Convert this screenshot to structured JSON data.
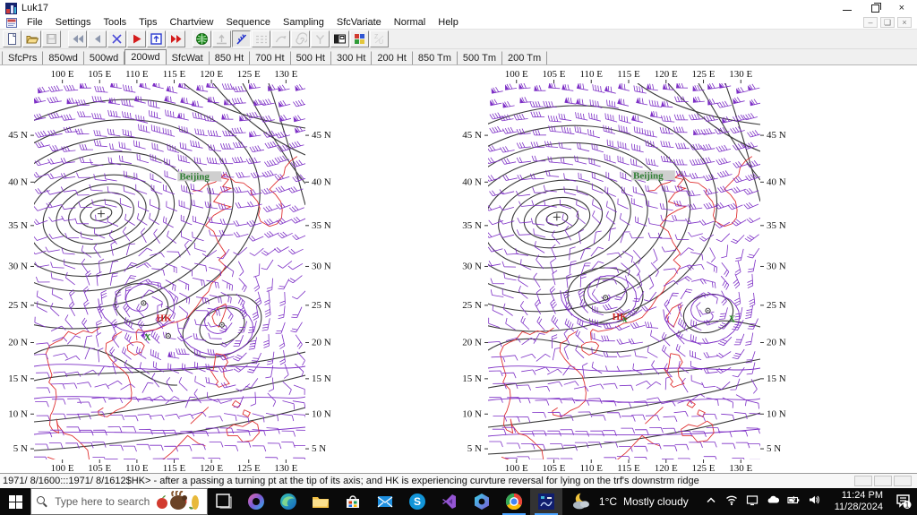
{
  "window": {
    "title": "Luk17"
  },
  "menu": {
    "items": [
      "File",
      "Settings",
      "Tools",
      "Tips",
      "Chartview",
      "Sequence",
      "Sampling",
      "SfcVariate",
      "Normal",
      "Help"
    ]
  },
  "toolbar": {
    "buttons": [
      {
        "name": "new",
        "enabled": true
      },
      {
        "name": "open",
        "enabled": true
      },
      {
        "name": "save",
        "enabled": false
      },
      {
        "name": "rewind",
        "enabled": true
      },
      {
        "name": "step-back",
        "enabled": true
      },
      {
        "name": "delete",
        "enabled": true
      },
      {
        "name": "play",
        "enabled": true
      },
      {
        "name": "fit-frame",
        "enabled": true
      },
      {
        "name": "fast-forward",
        "enabled": true
      },
      {
        "name": "globe",
        "enabled": true
      },
      {
        "name": "surface",
        "enabled": false
      },
      {
        "name": "wind-feather",
        "enabled": true,
        "active": true
      },
      {
        "name": "isolines",
        "enabled": false
      },
      {
        "name": "curve-arrow",
        "enabled": false
      },
      {
        "name": "spiral",
        "enabled": false
      },
      {
        "name": "branch",
        "enabled": false
      },
      {
        "name": "window-layout",
        "enabled": true
      },
      {
        "name": "palette",
        "enabled": true
      },
      {
        "name": "zu",
        "enabled": false
      }
    ]
  },
  "tabs": {
    "active_index": 3,
    "items": [
      "SfcPrs",
      "850wd",
      "500wd",
      "200wd",
      "SfcWat",
      "850 Ht",
      "700 Ht",
      "500 Ht",
      "300 Ht",
      "200 Ht",
      "850 Tm",
      "500 Tm",
      "200 Tm"
    ]
  },
  "chart": {
    "lon_labels": [
      "100 E",
      "105 E",
      "110 E",
      "115 E",
      "120 E",
      "125 E",
      "130 E"
    ],
    "lat_labels": [
      "45 N",
      "40 N",
      "35 N",
      "30 N",
      "25 N",
      "20 N",
      "15 N",
      "10 N",
      "5 N"
    ],
    "colors": {
      "contour": "#3a3a3a",
      "wind": "#7d2fc6",
      "coast": "#e03232",
      "green": "#2e7d32",
      "red": "#cc2222"
    },
    "panels": [
      {
        "name": "left-map",
        "annotations": [
          {
            "type": "label",
            "text": "Beijing",
            "lon": 115.7,
            "lat": 40.3,
            "color": "#2e7d32",
            "highlight": true
          },
          {
            "type": "plus",
            "text": "+",
            "lon": 105.2,
            "lat": 36.4,
            "color": "#333333"
          },
          {
            "type": "vortex",
            "lon": 110.9,
            "lat": 25.3
          },
          {
            "type": "vortex",
            "lon": 121.4,
            "lat": 22.4
          },
          {
            "type": "vortex",
            "lon": 114.2,
            "lat": 20.9
          },
          {
            "type": "label",
            "text": "HK",
            "lon": 112.6,
            "lat": 22.9,
            "color": "#cc2222"
          },
          {
            "type": "x",
            "text": "X",
            "lon": 111.0,
            "lat": 20.3,
            "color": "#1f8a1f"
          }
        ]
      },
      {
        "name": "right-map",
        "annotations": [
          {
            "type": "label",
            "text": "Beijing",
            "lon": 115.6,
            "lat": 40.4,
            "color": "#2e7d32",
            "highlight": true
          },
          {
            "type": "plus",
            "text": "+",
            "lon": 105.4,
            "lat": 36.0,
            "color": "#333333"
          },
          {
            "type": "vortex",
            "lon": 111.9,
            "lat": 26.0
          },
          {
            "type": "vortex",
            "lon": 125.6,
            "lat": 24.3
          },
          {
            "type": "label",
            "text": "HK",
            "lon": 112.8,
            "lat": 23.1,
            "color": "#cc2222"
          },
          {
            "type": "x",
            "text": "x",
            "lon": 114.2,
            "lat": 22.8,
            "color": "#1f8a1f"
          },
          {
            "type": "x",
            "text": "X",
            "lon": 128.4,
            "lat": 22.8,
            "color": "#1f8a1f"
          }
        ]
      }
    ]
  },
  "status_bar": {
    "text": "1971/ 8/1600:::1971/ 8/1612$HK> - after a passing  a turning pt at the tip of its axis; and HK is experiencing curvture reversal for lying on the trf's downstrm ridge"
  },
  "taskbar": {
    "search": {
      "placeholder": "Type here to search"
    },
    "apps": [
      {
        "name": "task-view",
        "running": false,
        "active": false
      },
      {
        "name": "copilot",
        "running": false,
        "active": false
      },
      {
        "name": "edge",
        "running": false,
        "active": false
      },
      {
        "name": "file-explorer",
        "running": false,
        "active": false
      },
      {
        "name": "microsoft-store",
        "running": false,
        "active": false
      },
      {
        "name": "mail",
        "running": false,
        "active": false
      },
      {
        "name": "skype",
        "running": false,
        "active": false
      },
      {
        "name": "visual-studio",
        "running": false,
        "active": false
      },
      {
        "name": "dev-home",
        "running": false,
        "active": false
      },
      {
        "name": "chrome",
        "running": true,
        "active": false
      },
      {
        "name": "luk17",
        "running": true,
        "active": true
      }
    ],
    "weather": {
      "temperature": "1°C",
      "condition": "Mostly cloudy"
    },
    "tray": [
      "chevron-up",
      "wifi",
      "display",
      "onedrive",
      "battery",
      "volume"
    ],
    "clock": {
      "time": "11:24 PM",
      "date": "11/28/2024"
    },
    "notifications": {
      "count": "1"
    }
  }
}
